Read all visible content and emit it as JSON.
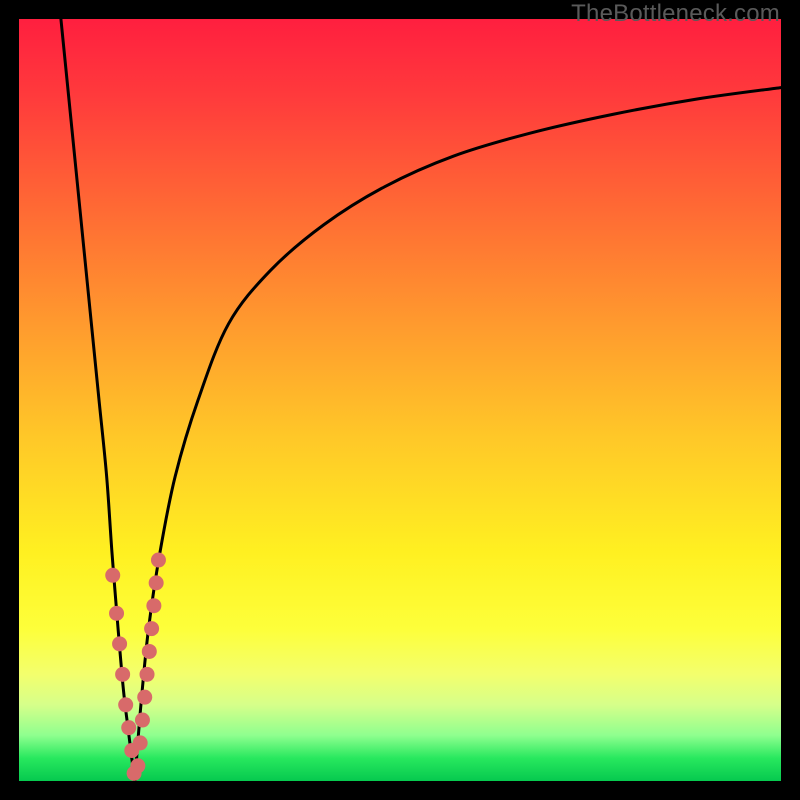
{
  "watermark": {
    "text": "TheBottleneck.com"
  },
  "colors": {
    "frame": "#000000",
    "curve": "#000000",
    "dots": "#d86a6a",
    "gradient_top": "#ff1f3f",
    "gradient_bottom": "#06c94f"
  },
  "chart_data": {
    "type": "line",
    "title": "",
    "xlabel": "",
    "ylabel": "",
    "xlim": [
      0,
      100
    ],
    "ylim": [
      0,
      100
    ],
    "grid": false,
    "series": [
      {
        "name": "curve-left",
        "x": [
          5.5,
          6.5,
          7.5,
          8.5,
          9.5,
          10.5,
          11.5,
          12.2,
          13.0,
          13.7,
          14.3,
          14.8,
          15.2
        ],
        "y": [
          100,
          90,
          80,
          70,
          60,
          50,
          40,
          30,
          20,
          12,
          7,
          3,
          0
        ]
      },
      {
        "name": "curve-right",
        "x": [
          15.2,
          16.0,
          17.0,
          18.5,
          20.5,
          23.5,
          27.5,
          33.0,
          40.0,
          48.0,
          57.0,
          67.0,
          78.0,
          89.0,
          100.0
        ],
        "y": [
          0,
          10,
          20,
          30,
          40,
          50,
          60,
          67,
          73,
          78,
          82,
          85,
          87.5,
          89.5,
          91
        ]
      }
    ],
    "scatter": [
      {
        "name": "dots-left",
        "x": [
          12.3,
          12.8,
          13.2,
          13.6,
          14.0,
          14.4,
          14.8,
          15.1
        ],
        "y": [
          27,
          22,
          18,
          14,
          10,
          7,
          4,
          1
        ]
      },
      {
        "name": "dots-right",
        "x": [
          15.6,
          15.9,
          16.2,
          16.5,
          16.8,
          17.1,
          17.4,
          17.7,
          18.0,
          18.3
        ],
        "y": [
          2,
          5,
          8,
          11,
          14,
          17,
          20,
          23,
          26,
          29
        ]
      }
    ],
    "note": "Percent-space coords; x/y in [0,100]; y=0 is bottom (green), y=100 is top (red)."
  }
}
